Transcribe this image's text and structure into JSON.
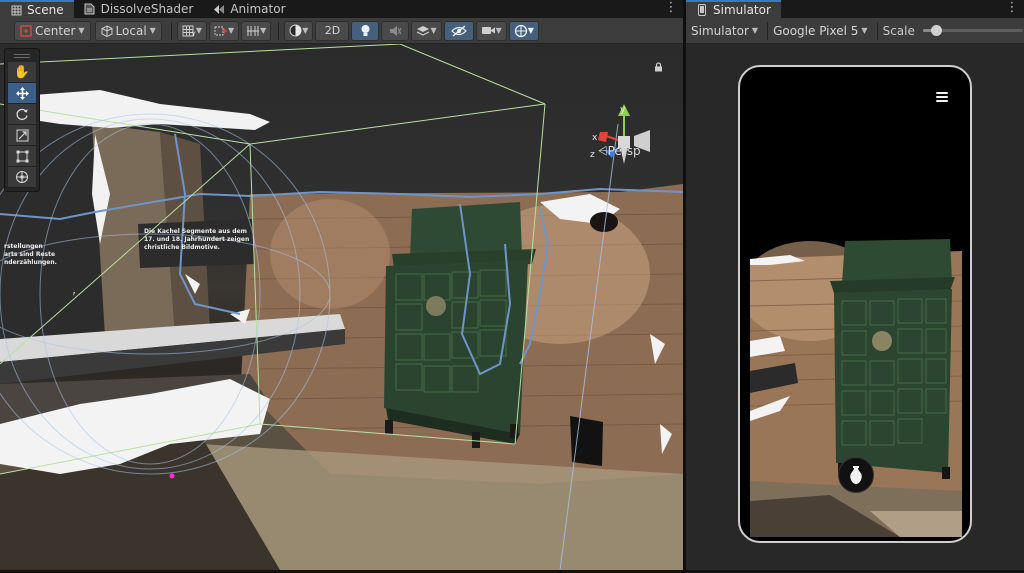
{
  "scene_window": {
    "tabs": [
      {
        "label": "Scene",
        "icon": "grid-icon",
        "active": true
      },
      {
        "label": "DissolveShader",
        "icon": "shader-file-icon",
        "active": false
      },
      {
        "label": "Animator",
        "icon": "animator-icon",
        "active": false
      }
    ],
    "toolbar": {
      "pivot_label": "Center",
      "space_label": "Local",
      "mode_2d_label": "2D"
    },
    "tools": [
      "hand-tool",
      "move-tool",
      "rotate-tool",
      "scale-tool",
      "rect-tool",
      "transform-tool"
    ],
    "active_tool": "move-tool",
    "gizmo": {
      "axis_x": "x",
      "axis_y": "y",
      "axis_z": "z",
      "projection_label": "Persp",
      "colors": {
        "x": "#e0463b",
        "y": "#8fd14f",
        "z": "#3f7ee0"
      }
    },
    "scene_sign": {
      "left": [
        "rstellungen",
        "arts sind Reste",
        "nderzählungen."
      ],
      "right": [
        "Die Kachel Segmente aus dem",
        "17. und 18. Jahrhundert zeigen",
        "christliche Bildmotive."
      ]
    }
  },
  "simulator_window": {
    "tab_label": "Simulator",
    "tab_icon": "phone-icon",
    "toolbar": {
      "mode_label": "Simulator",
      "device_label": "Google Pixel 5",
      "scale_label": "Scale",
      "scale_value": 0.13
    },
    "app_ui": {
      "menu_icon": "hamburger-menu-icon",
      "action_icon": "vase-icon"
    }
  },
  "colors": {
    "accent": "#3a79bb",
    "selection_outline": "#6f95c8",
    "bounds_box": "#b8e0a0"
  }
}
